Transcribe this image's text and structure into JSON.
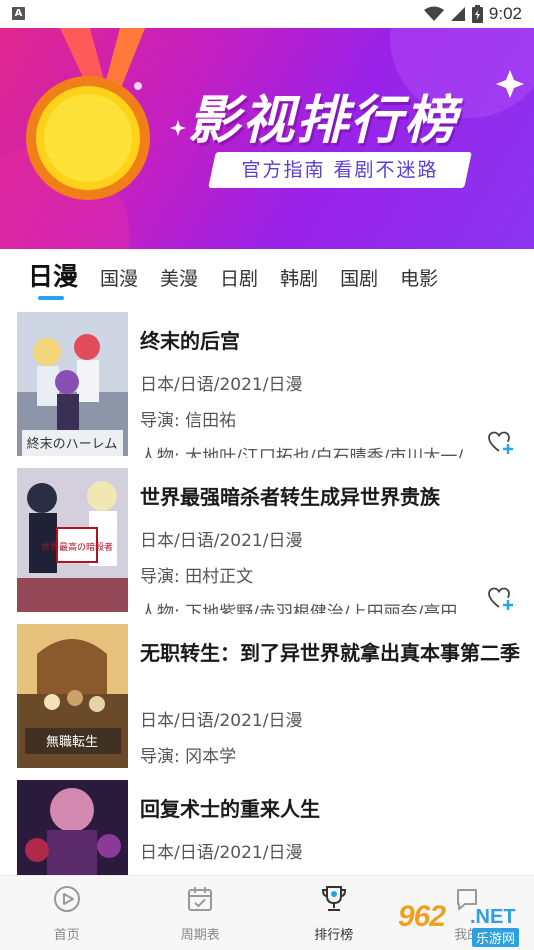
{
  "status_bar": {
    "badge": "A",
    "time": "9:02"
  },
  "banner": {
    "title": "影视排行榜",
    "subtitle": "官方指南 看剧不迷路"
  },
  "tabs": [
    {
      "label": "日漫",
      "active": true
    },
    {
      "label": "国漫"
    },
    {
      "label": "美漫"
    },
    {
      "label": "日剧"
    },
    {
      "label": "韩剧"
    },
    {
      "label": "国剧"
    },
    {
      "label": "电影"
    }
  ],
  "items": [
    {
      "title": "终末的后宫",
      "meta": "日本/日语/2021/日漫",
      "director": "导演: 信田祐",
      "cast": "人物: 大地叶/江口拓也/白石晴香/市川太一/",
      "poster_text": "終末のハーレム"
    },
    {
      "title": "世界最强暗杀者转生成异世界贵族",
      "meta": "日本/日语/2021/日漫",
      "director": "导演: 田村正文",
      "cast": "人物: 下地紫野/赤羽根健治/上田丽奈/高田",
      "poster_text": "世界最高の暗殺者"
    },
    {
      "title": "无职转生：到了异世界就拿出真本事第二季",
      "meta": "日本/日语/2021/日漫",
      "director": "导演: 冈本学",
      "poster_text": "無職転生"
    },
    {
      "title": "回复术士的重来人生",
      "meta": "日本/日语/2021/日漫"
    }
  ],
  "bottom_nav": [
    {
      "label": "首页",
      "icon": "play-circle-icon"
    },
    {
      "label": "周期表",
      "icon": "calendar-icon"
    },
    {
      "label": "排行榜",
      "icon": "trophy-icon",
      "active": true
    },
    {
      "label": "我的",
      "icon": "chat-icon"
    }
  ],
  "watermark": {
    "number": "962",
    "domain": ".NET",
    "sub": "乐游网"
  },
  "colors": {
    "accent": "#25a4f0",
    "banner_start": "#e1268d",
    "banner_end": "#8a35f0"
  }
}
